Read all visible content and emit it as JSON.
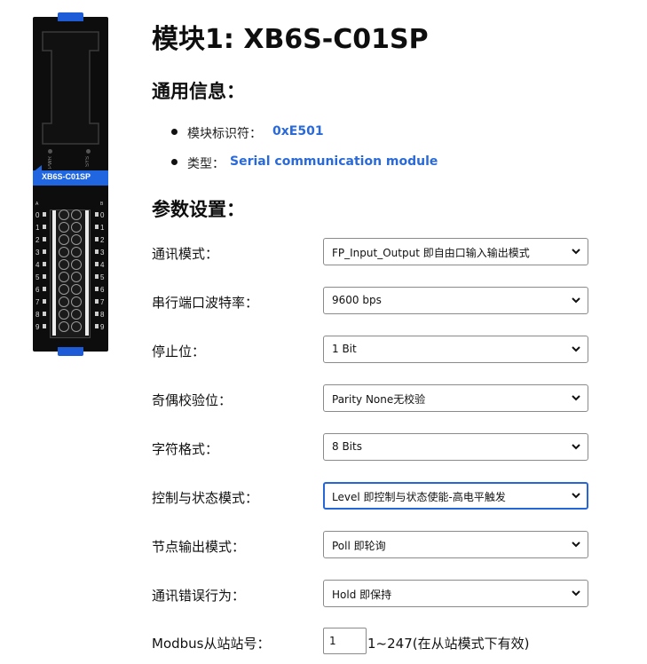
{
  "device": {
    "label": "XB6S-C01SP",
    "led_pwr": "PWR",
    "led_sys": "SYS",
    "col_a": "A",
    "col_b": "B",
    "terminal_numbers": [
      "0",
      "1",
      "2",
      "3",
      "4",
      "5",
      "6",
      "7",
      "8",
      "9"
    ],
    "body_color": "#0d0d0d",
    "accent_color": "#1f66e0"
  },
  "title": "模块1: XB6S-C01SP",
  "general": {
    "heading": "通用信息：",
    "items": [
      {
        "label": "模块标识符：",
        "value": "0xE501"
      },
      {
        "label": "类型：",
        "value": "Serial communication module"
      }
    ]
  },
  "params": {
    "heading": "参数设置：",
    "fields": [
      {
        "label": "通讯模式：",
        "value": "FP_Input_Output 即自由口输入输出模式",
        "focused": false
      },
      {
        "label": "串行端口波特率：",
        "value": "9600 bps",
        "focused": false
      },
      {
        "label": "停止位：",
        "value": "1 Bit",
        "focused": false
      },
      {
        "label": "奇偶校验位：",
        "value": "Parity None无校验",
        "focused": false
      },
      {
        "label": "字符格式：",
        "value": "8 Bits",
        "focused": false
      },
      {
        "label": "控制与状态模式：",
        "value": "Level 即控制与状态使能-高电平触发",
        "focused": true
      },
      {
        "label": "节点输出模式：",
        "value": "Poll 即轮询",
        "focused": false
      },
      {
        "label": "通讯错误行为：",
        "value": "Hold 即保持",
        "focused": false
      }
    ],
    "station": {
      "label": "Modbus从站站号：",
      "value": "1",
      "note": "1~247(在从站模式下有效)"
    }
  },
  "colors": {
    "link_blue": "#2a6ad8",
    "focus_blue": "#2566d8"
  }
}
